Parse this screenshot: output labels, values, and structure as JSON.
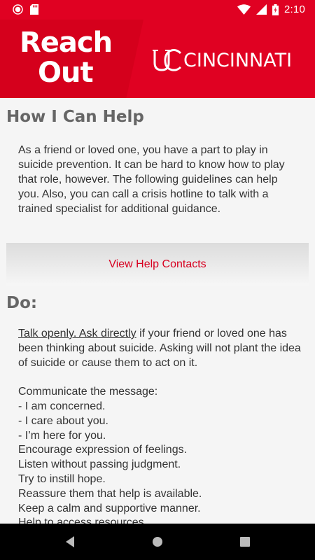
{
  "status_bar": {
    "time": "2:10"
  },
  "header": {
    "title_line1": "Reach",
    "title_line2": "Out",
    "brand": "CINCINNATI"
  },
  "intro_section": {
    "title": "How I Can Help",
    "body": "As a friend or loved one, you have a part to play in suicide prevention. It can be hard to know how to play that role, however. The following guidelines can help you. Also, you can call a crisis hotline to talk with a trained specialist for additional guidance."
  },
  "help_button": {
    "label": "View Help Contacts"
  },
  "do_section": {
    "title": "Do:",
    "link_text": "Talk openly. Ask directly",
    "first_para_rest": " if your friend or loved one has been thinking about suicide. Asking will not plant the idea of suicide or cause them to act on it.",
    "lines": [
      "Communicate the message:",
      "- I am concerned.",
      "- I care about you.",
      "- I’m here for you.",
      "Encourage expression of feelings.",
      "Listen without passing judgment.",
      "Try to instill hope.",
      "Reassure them that help is available.",
      "Keep a calm and supportive manner.",
      "Help to access resources."
    ]
  },
  "icons": {
    "status_left": [
      "recording-icon",
      "sd-card-icon"
    ],
    "status_right": [
      "wifi-icon",
      "signal-icon",
      "battery-icon"
    ],
    "nav": [
      "back-icon",
      "home-icon",
      "recents-icon"
    ]
  },
  "colors": {
    "brand_red": "#e00122",
    "link_red": "#d80020",
    "heading_gray": "#666666"
  }
}
